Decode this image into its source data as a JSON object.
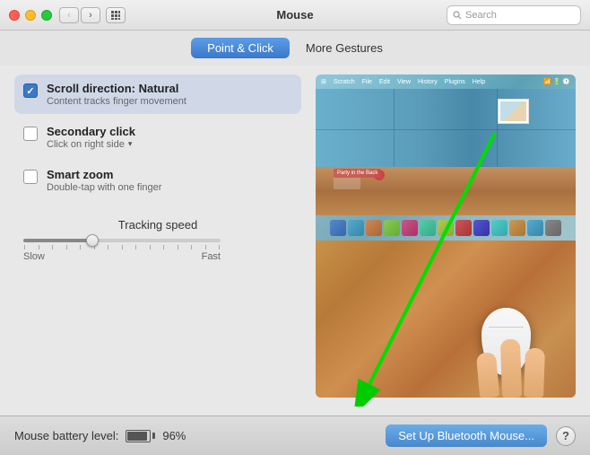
{
  "titlebar": {
    "title": "Mouse",
    "search_placeholder": "Search",
    "back_btn": "‹",
    "forward_btn": "›",
    "grid_btn": "⋯"
  },
  "tabs": [
    {
      "id": "point-click",
      "label": "Point & Click",
      "active": true
    },
    {
      "id": "more-gestures",
      "label": "More Gestures",
      "active": false
    }
  ],
  "preferences": [
    {
      "id": "scroll-direction",
      "title": "Scroll direction: Natural",
      "subtitle": "Content tracks finger movement",
      "checked": true,
      "selected": true
    },
    {
      "id": "secondary-click",
      "title": "Secondary click",
      "subtitle": "Click on right side",
      "checked": false,
      "selected": false
    },
    {
      "id": "smart-zoom",
      "title": "Smart zoom",
      "subtitle": "Double-tap with one finger",
      "checked": false,
      "selected": false
    }
  ],
  "tracking": {
    "label": "Tracking speed",
    "slow_label": "Slow",
    "fast_label": "Fast"
  },
  "bottombar": {
    "battery_label": "Mouse battery level:",
    "battery_percent": "96%",
    "bluetooth_btn": "Set Up Bluetooth Mouse...",
    "help_btn": "?"
  }
}
